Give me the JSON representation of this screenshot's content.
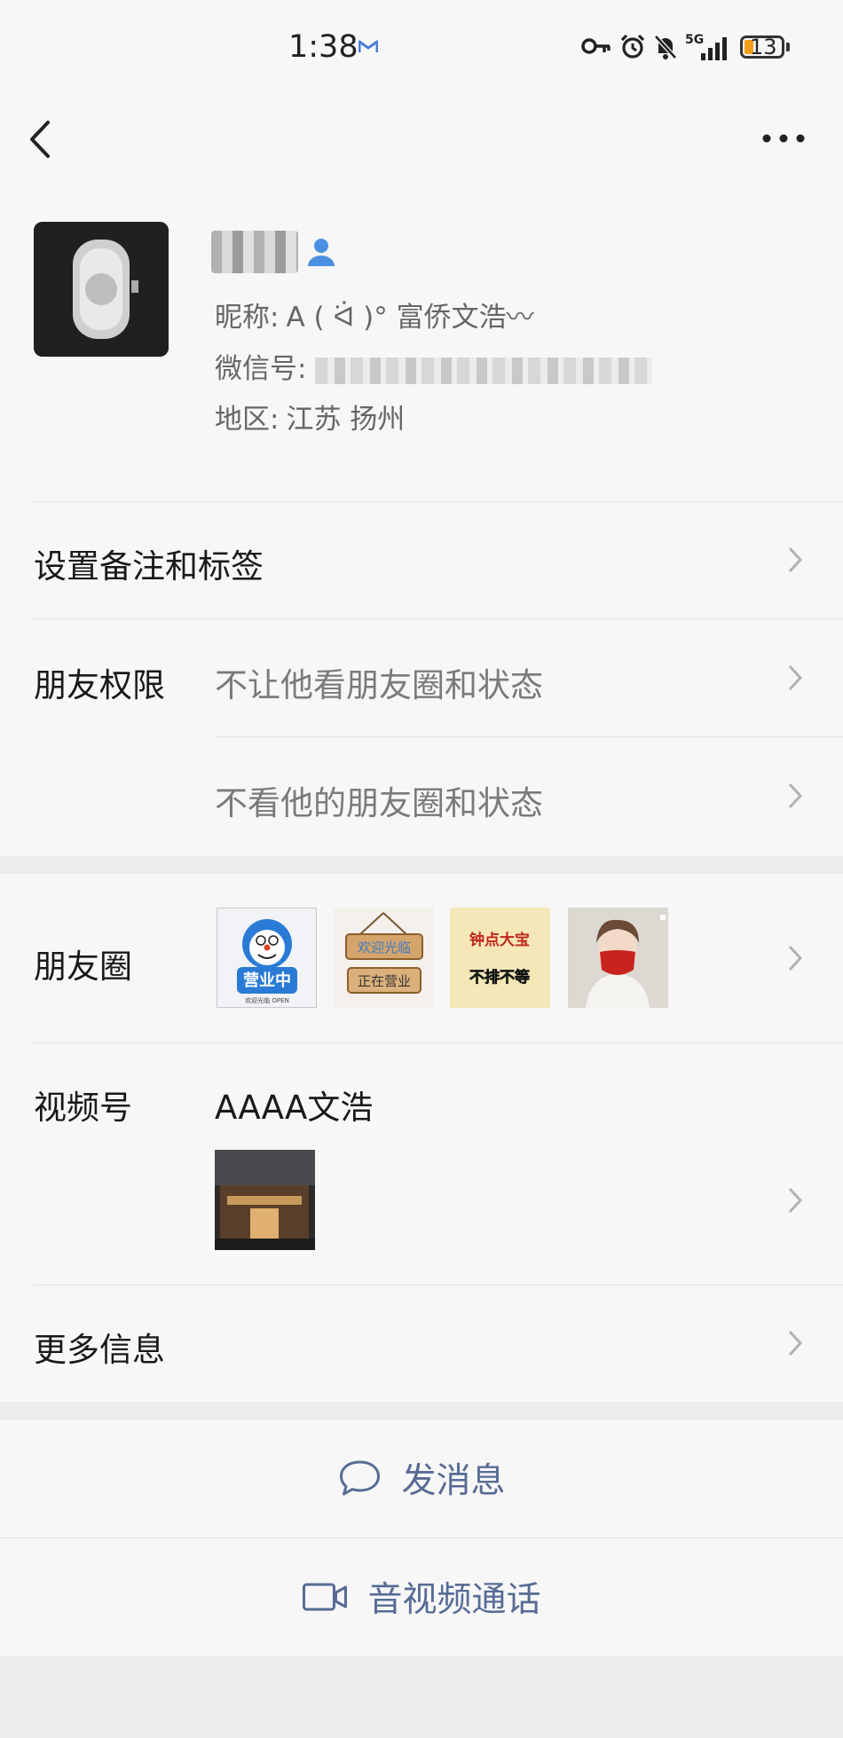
{
  "status_bar": {
    "time": "1:38",
    "battery": "13"
  },
  "profile": {
    "nickname_label": "昵称:",
    "nickname_value": "A ( ᐛ )° 富侨文浩〰",
    "wechat_id_label": "微信号:",
    "region_label": "地区:",
    "region_value": "江苏  扬州"
  },
  "rows": {
    "remark_tags": "设置备注和标签",
    "friend_permissions_label": "朋友权限",
    "permission_1": "不让他看朋友圈和状态",
    "permission_2": "不看他的朋友圈和状态",
    "moments_label": "朋友圈",
    "channels_label": "视频号",
    "channels_name": "AAAA文浩",
    "more_info": "更多信息"
  },
  "moments_thumbs": [
    {
      "text_top": "",
      "text_bottom": "营业中",
      "sub": "欢迎光临 OPEN"
    },
    {
      "text_top": "欢迎光临",
      "text_bottom": "正在营业"
    },
    {
      "text_top": "钟点大宝",
      "text_bottom": "不排不等"
    }
  ],
  "actions": {
    "message": "发消息",
    "call": "音视频通话"
  },
  "colors": {
    "link_blue": "#576b95",
    "contact_icon_blue": "#4a90e2",
    "page_bg": "#f7f7f7",
    "gap_bg": "#ededed"
  }
}
